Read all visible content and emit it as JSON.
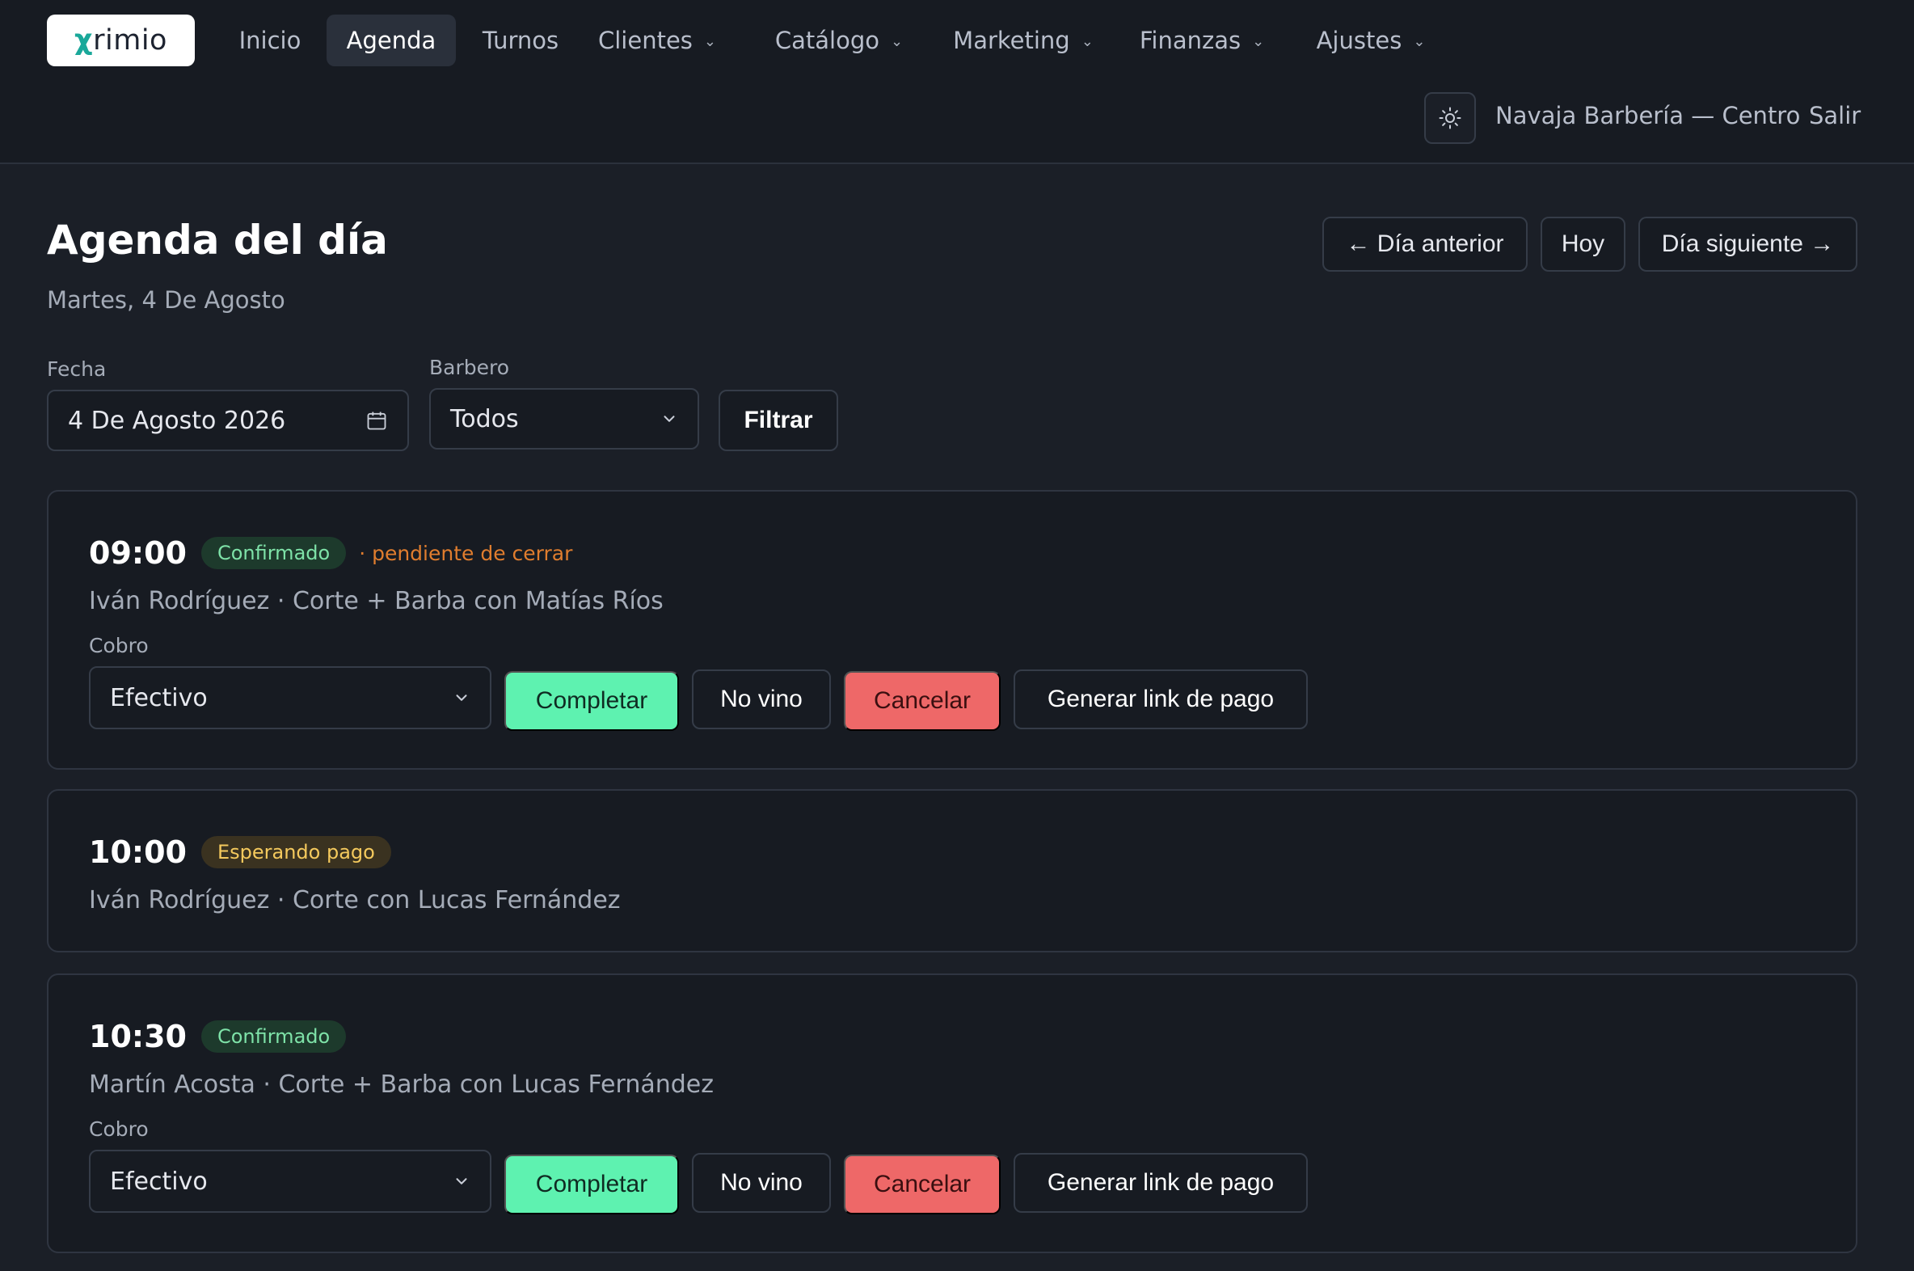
{
  "header": {
    "logo_text": "rimio",
    "logo_mark": "χ",
    "nav": [
      {
        "label": "Inicio",
        "active": false,
        "dropdown": false
      },
      {
        "label": "Agenda",
        "active": true,
        "dropdown": false
      },
      {
        "label": "Turnos",
        "active": false,
        "dropdown": false
      },
      {
        "label": "Clientes",
        "active": false,
        "dropdown": true
      },
      {
        "label": "Catálogo",
        "active": false,
        "dropdown": true
      },
      {
        "label": "Marketing",
        "active": false,
        "dropdown": true
      },
      {
        "label": "Finanzas",
        "active": false,
        "dropdown": true
      },
      {
        "label": "Ajustes",
        "active": false,
        "dropdown": true
      }
    ],
    "theme_toggle_icon": "sun-icon",
    "shop_name": "Navaja Barbería — Centro",
    "logout_label": "Salir"
  },
  "page": {
    "title": "Agenda del día",
    "subtitle": "Martes, 4 De Agosto",
    "prev_day_label": "← Día anterior",
    "today_label": "Hoy",
    "next_day_label": "Día siguiente →"
  },
  "filters": {
    "date_label": "Fecha",
    "date_value": "4 De Agosto 2026",
    "barber_label": "Barbero",
    "barber_value": "Todos",
    "filter_button": "Filtrar"
  },
  "appointments": [
    {
      "time": "09:00",
      "status": "Confirmado",
      "note": "· pendiente de cerrar",
      "description": "Iván Rodríguez · Corte + Barba con Matías Ríos",
      "cobro_label": "Cobro",
      "payment_method": "Efectivo",
      "actions": {
        "complete": "Completar",
        "no_show": "No vino",
        "cancel": "Cancelar",
        "payment_link": "Generar link de pago"
      }
    },
    {
      "time": "10:00",
      "status": "Esperando pago",
      "description": "Iván Rodríguez · Corte con Lucas Fernández"
    },
    {
      "time": "10:30",
      "status": "Confirmado",
      "description": "Martín Acosta · Corte + Barba con Lucas Fernández",
      "cobro_label": "Cobro",
      "payment_method": "Efectivo",
      "actions": {
        "complete": "Completar",
        "no_show": "No vino",
        "cancel": "Cancelar",
        "payment_link": "Generar link de pago"
      }
    }
  ],
  "colors": {
    "background": "#1b1f27",
    "complete": "#5ef2b0",
    "cancel": "#ee6868",
    "confirmed_badge": "#7ee2a8",
    "waiting_badge": "#f4c95d",
    "pending_note": "#e07d2e"
  }
}
